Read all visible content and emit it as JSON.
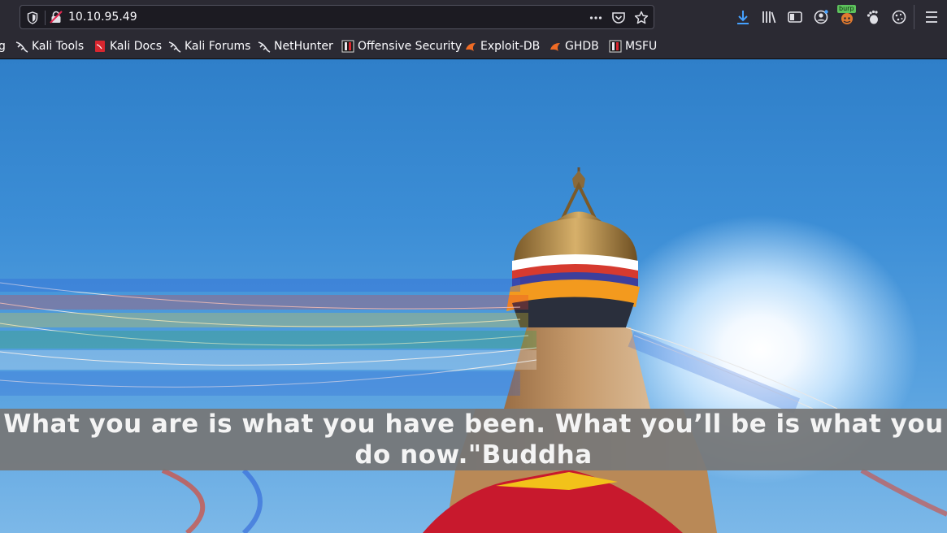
{
  "browser": {
    "url": "10.10.95.49",
    "burp_badge": "burp"
  },
  "bookmarks": [
    {
      "label": "g"
    },
    {
      "label": "Kali Tools"
    },
    {
      "label": "Kali Docs"
    },
    {
      "label": "Kali Forums"
    },
    {
      "label": "NetHunter"
    },
    {
      "label": "Offensive Security"
    },
    {
      "label": "Exploit-DB"
    },
    {
      "label": "GHDB"
    },
    {
      "label": "MSFU"
    }
  ],
  "page": {
    "quote": "What you are is what you have been. What you’ll be is what you do now.\"Buddha"
  },
  "colors": {
    "toolbar": "#2b2a33",
    "urlbar": "#1c1b22",
    "quote_bar": "#767676",
    "download_accent": "#45a1ff",
    "burp_badge": "#5dc25d"
  }
}
